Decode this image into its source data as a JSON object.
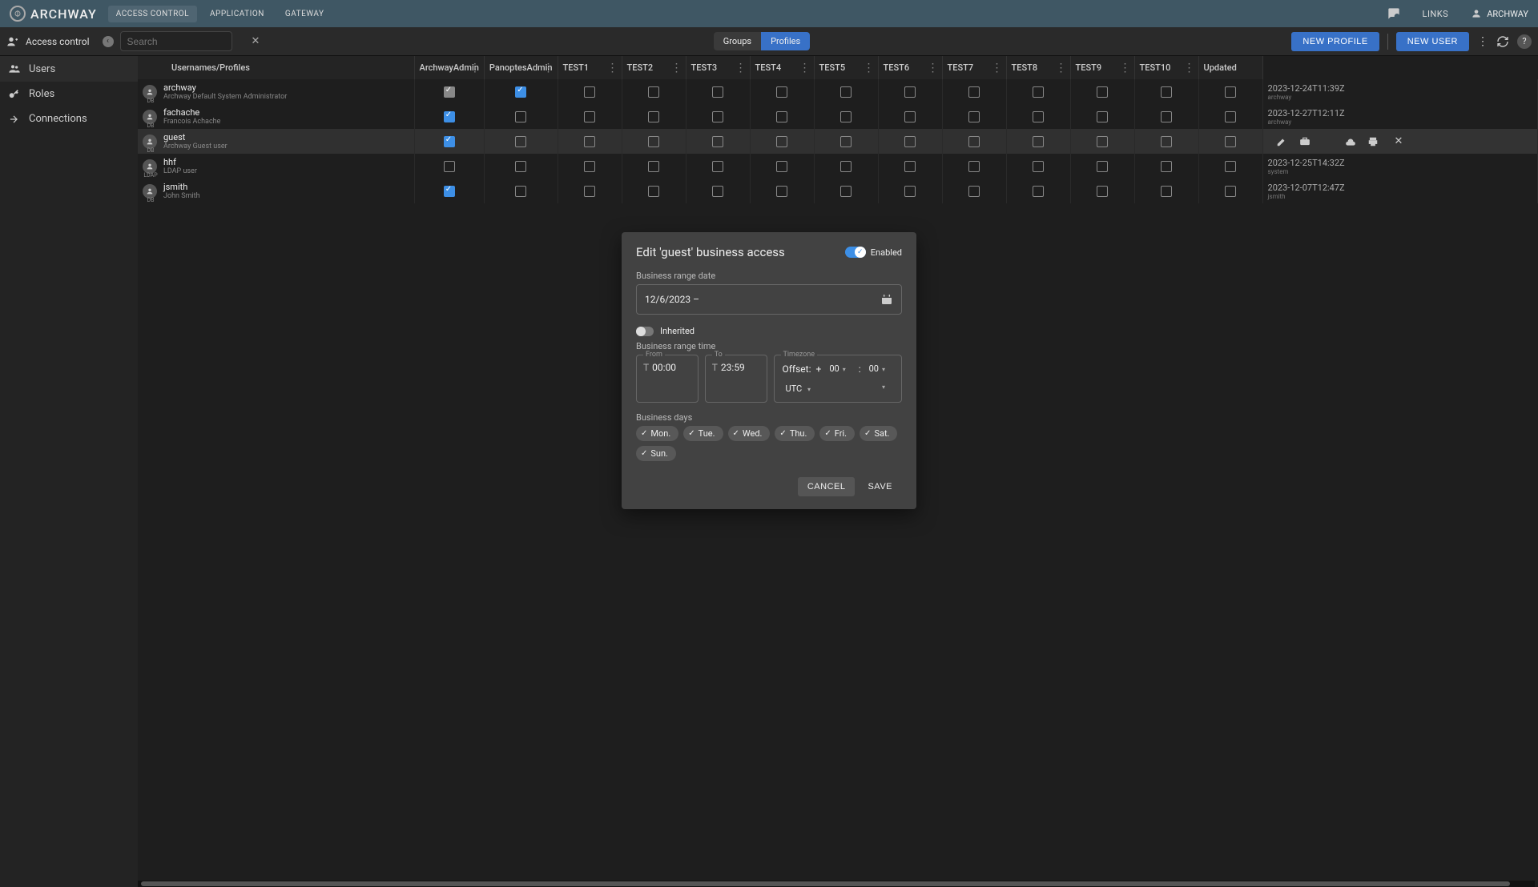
{
  "header": {
    "brand": "ARCHWAY",
    "tabs": [
      "ACCESS CONTROL",
      "APPLICATION",
      "GATEWAY"
    ],
    "links_label": "LINKS",
    "user_label": "ARCHWAY"
  },
  "toolbar": {
    "lefticon_label": "Access control",
    "search_placeholder": "Search",
    "toggle": [
      "Groups",
      "Profiles"
    ],
    "new_profile": "NEW PROFILE",
    "new_user": "NEW USER"
  },
  "sidebar": {
    "items": [
      "Users",
      "Roles",
      "Connections"
    ]
  },
  "table": {
    "headers": [
      "Usernames/Profiles",
      "ArchwayAdmin",
      "PanoptesAdmin",
      "TEST1",
      "TEST2",
      "TEST3",
      "TEST4",
      "TEST5",
      "TEST6",
      "TEST7",
      "TEST8",
      "TEST9",
      "TEST10",
      "Updated"
    ],
    "rows": [
      {
        "user": "archway",
        "sub": "Archway Default System Administrator",
        "src": "DB",
        "checks": [
          "indet",
          "on",
          "",
          "",
          "",
          "",
          "",
          "",
          "",
          "",
          "",
          "",
          ""
        ],
        "updated": "2023-12-24T11:39Z",
        "by": "archway"
      },
      {
        "user": "fachache",
        "sub": "Francois Achache",
        "src": "DB",
        "checks": [
          "on",
          "",
          "",
          "",
          "",
          "",
          "",
          "",
          "",
          "",
          "",
          "",
          ""
        ],
        "updated": "2023-12-27T12:11Z",
        "by": "archway"
      },
      {
        "user": "guest",
        "sub": "Archway Guest user",
        "src": "DB",
        "checks": [
          "on",
          "",
          "",
          "",
          "",
          "",
          "",
          "",
          "",
          "",
          "",
          "",
          ""
        ],
        "updated": "",
        "by": "",
        "selected": true
      },
      {
        "user": "hhf",
        "sub": "LDAP user",
        "src": "LDAP",
        "checks": [
          "",
          "",
          "",
          "",
          "",
          "",
          "",
          "",
          "",
          "",
          "",
          "",
          ""
        ],
        "updated": "2023-12-25T14:32Z",
        "by": "system"
      },
      {
        "user": "jsmith",
        "sub": "John Smith",
        "src": "DB",
        "checks": [
          "on",
          "",
          "",
          "",
          "",
          "",
          "",
          "",
          "",
          "",
          "",
          "",
          ""
        ],
        "updated": "2023-12-07T12:47Z",
        "by": "jsmith"
      }
    ]
  },
  "dialog": {
    "title": "Edit 'guest' business access",
    "enabled_label": "Enabled",
    "range_date_label": "Business range date",
    "date_value": "12/6/2023  –",
    "inherited_label": "Inherited",
    "range_time_label": "Business range time",
    "from_label": "From",
    "from_value": "00:00",
    "to_label": "To",
    "to_value": "23:59",
    "timezone_label": "Timezone",
    "offset_label": "Offset:",
    "offset_sign": "+",
    "offset_hh": "00",
    "offset_sep": ":",
    "offset_mm": "00",
    "tz_value": "UTC",
    "days_label": "Business days",
    "days": [
      "Mon.",
      "Tue.",
      "Wed.",
      "Thu.",
      "Fri.",
      "Sat.",
      "Sun."
    ],
    "cancel": "CANCEL",
    "save": "SAVE"
  }
}
